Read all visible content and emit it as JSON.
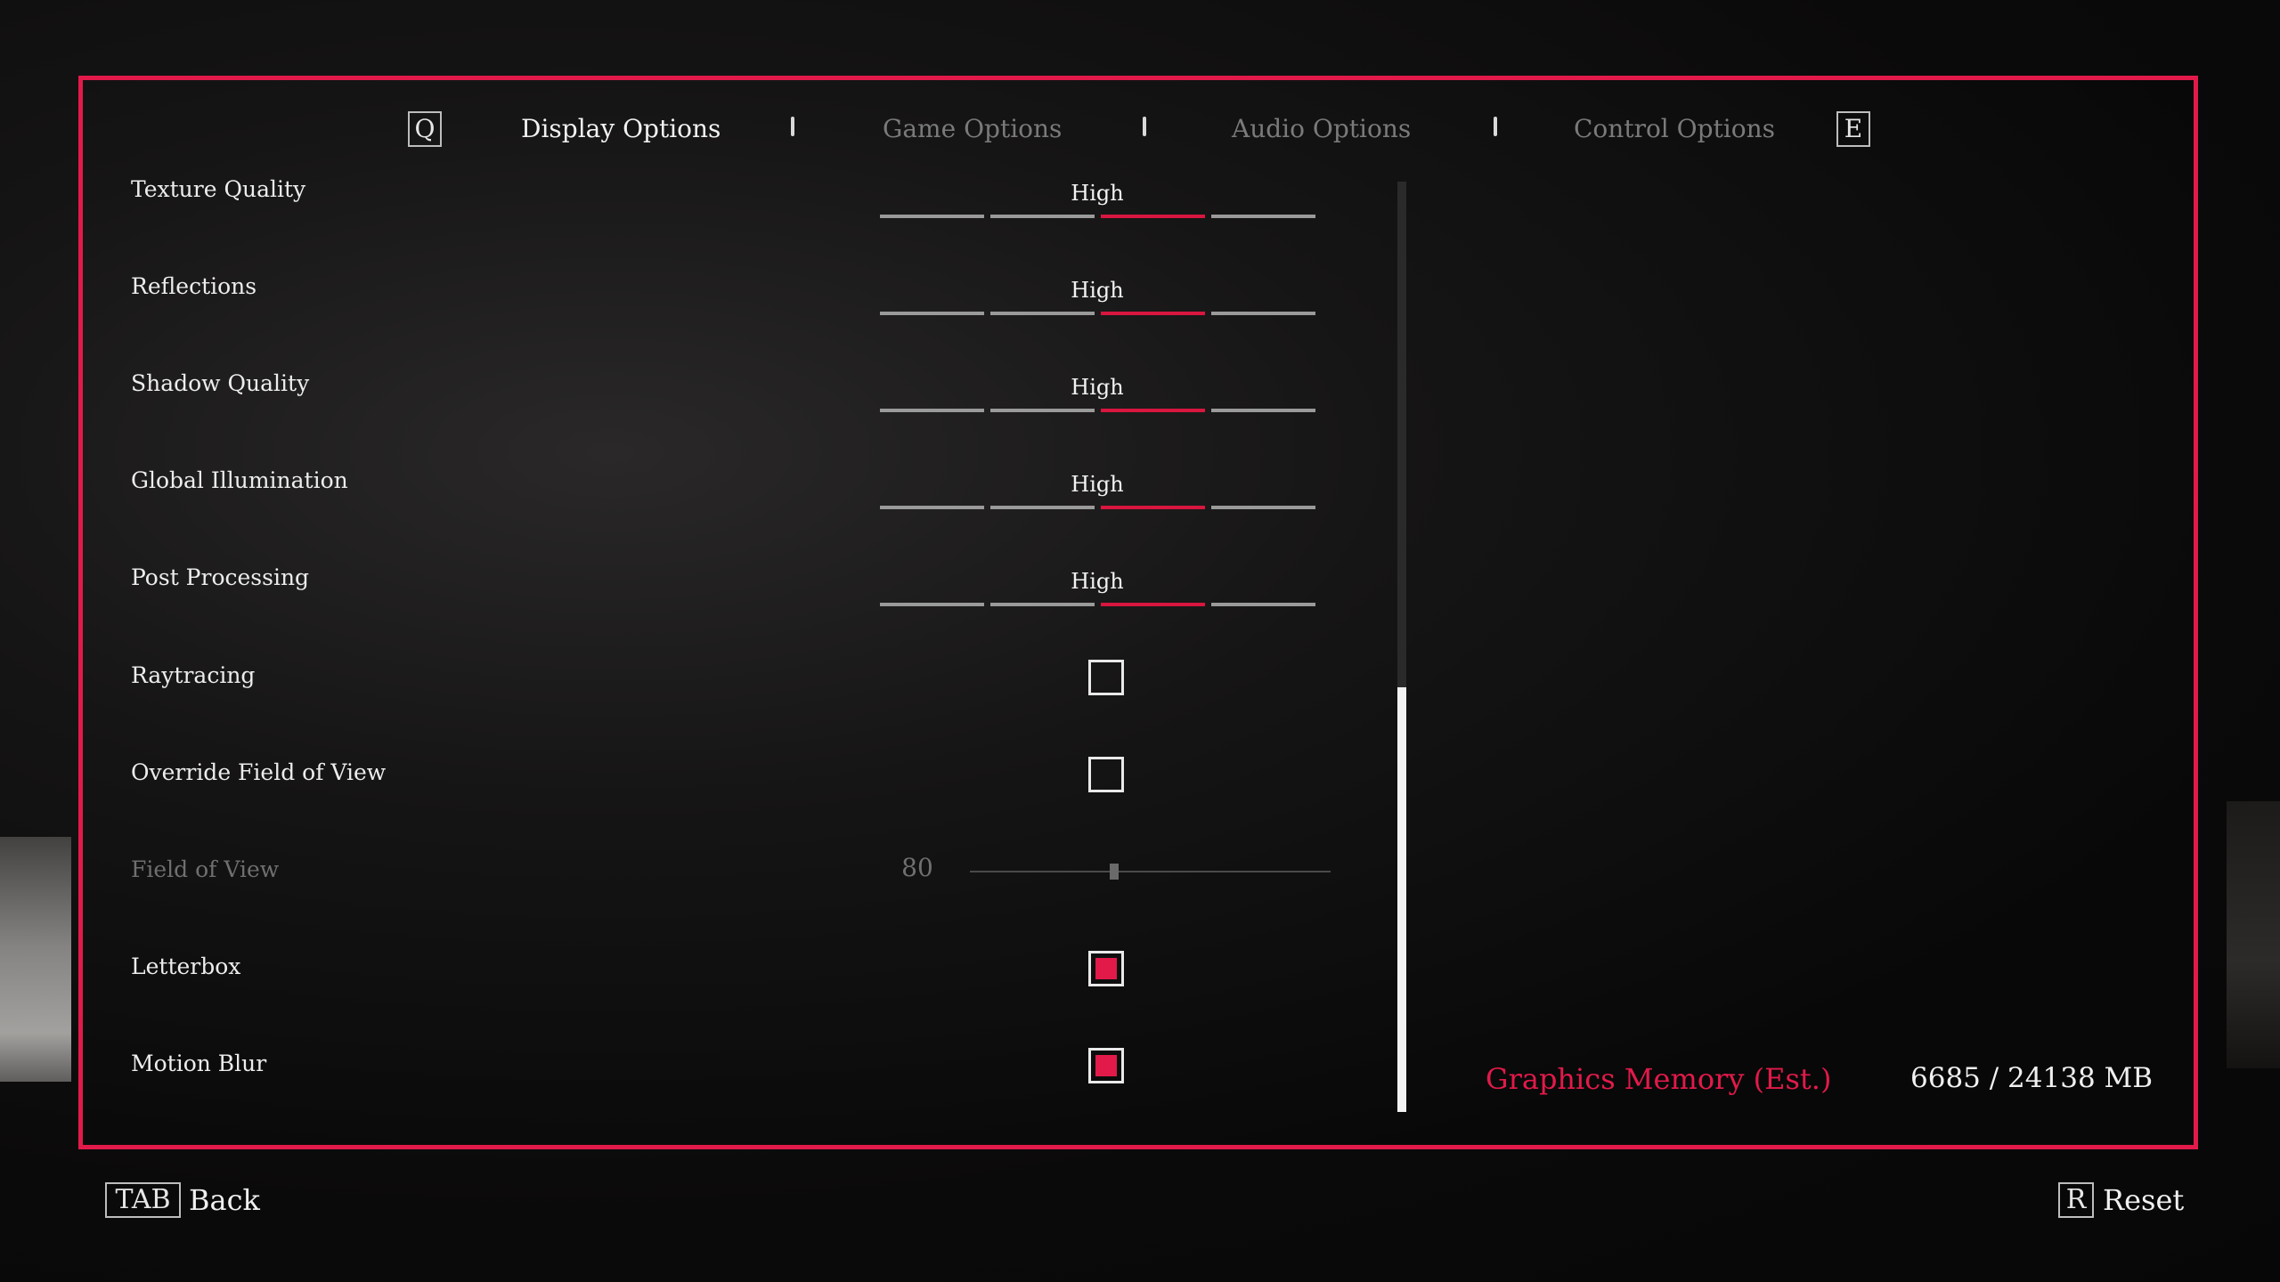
{
  "tabs": {
    "prev_key": "Q",
    "next_key": "E",
    "items": [
      {
        "label": "Display Options",
        "active": true
      },
      {
        "label": "Game Options",
        "active": false
      },
      {
        "label": "Audio Options",
        "active": false
      },
      {
        "label": "Control Options",
        "active": false
      }
    ]
  },
  "settings": {
    "texture_quality": {
      "label": "Texture Quality",
      "value": "High",
      "level": 3,
      "levels": 4
    },
    "reflections": {
      "label": "Reflections",
      "value": "High",
      "level": 3,
      "levels": 4
    },
    "shadow_quality": {
      "label": "Shadow Quality",
      "value": "High",
      "level": 3,
      "levels": 4
    },
    "global_illumination": {
      "label": "Global Illumination",
      "value": "High",
      "level": 3,
      "levels": 4
    },
    "post_processing": {
      "label": "Post Processing",
      "value": "High",
      "level": 3,
      "levels": 4
    },
    "raytracing": {
      "label": "Raytracing",
      "checked": false
    },
    "override_fov": {
      "label": "Override Field of View",
      "checked": false
    },
    "field_of_view": {
      "label": "Field of View",
      "value": "80",
      "slider_fraction": 0.4,
      "enabled": false
    },
    "letterbox": {
      "label": "Letterbox",
      "checked": true
    },
    "motion_blur": {
      "label": "Motion Blur",
      "checked": true
    }
  },
  "scroll": {
    "position_fraction": 1.0
  },
  "memory": {
    "label": "Graphics Memory (Est.)",
    "value": "6685 / 24138 MB"
  },
  "footer": {
    "back_key": "TAB",
    "back_label": "Back",
    "reset_key": "R",
    "reset_label": "Reset"
  },
  "colors": {
    "accent": "#e21a4a",
    "text": "#ededed",
    "dim": "#6f6f6f"
  }
}
